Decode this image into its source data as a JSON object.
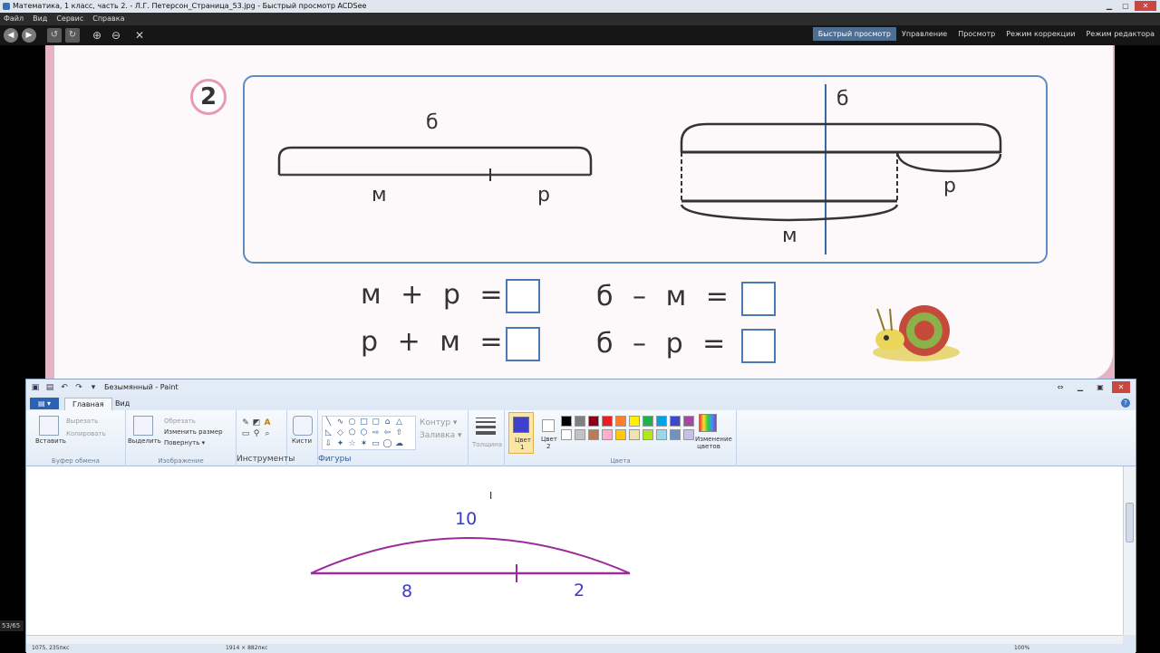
{
  "acdsee": {
    "title": "Математика, 1 класс, часть 2. - Л.Г. Петерсон_Страница_53.jpg - Быстрый просмотр ACDSee",
    "menu": [
      "Файл",
      "Вид",
      "Сервис",
      "Справка"
    ],
    "modes": [
      "Быстрый просмотр",
      "Управление",
      "Просмотр",
      "Режим коррекции",
      "Режим редактора"
    ],
    "active_mode": "Быстрый просмотр",
    "page_counter": "53/65"
  },
  "textbook": {
    "task_number": "2",
    "left_diagram": {
      "top": "б",
      "left_part": "м",
      "right_part": "р"
    },
    "right_diagram": {
      "top": "б",
      "right_part": "р",
      "bottom": "м"
    },
    "equations": [
      {
        "text": "м + р ="
      },
      {
        "text": "р + м ="
      },
      {
        "text": "б – м ="
      },
      {
        "text": "б – р ="
      }
    ]
  },
  "paint": {
    "title": "Безымянный - Paint",
    "file_tab": "▤ ▾",
    "tabs": [
      "Главная",
      "Вид"
    ],
    "active_tab": "Главная",
    "clipboard": {
      "paste": "Вставить",
      "cut": "Вырезать",
      "copy": "Копировать",
      "label": "Буфер обмена"
    },
    "image": {
      "select": "Выделить",
      "crop": "Обрезать",
      "resize": "Изменить размер",
      "rotate": "Повернуть ▾",
      "label": "Изображение"
    },
    "tools": {
      "label": "Инструменты"
    },
    "brushes": {
      "label": "Кисти"
    },
    "shapes": {
      "outline": "Контур ▾",
      "fill": "Заливка ▾",
      "label": "Фигуры"
    },
    "size": {
      "label": "Толщина"
    },
    "color1": {
      "label1": "Цвет",
      "label2": "1",
      "value": "#3f3fd0"
    },
    "color2": {
      "label1": "Цвет",
      "label2": "2",
      "value": "#ffffff"
    },
    "colors": {
      "label": "Цвета",
      "edit": "Изменение цветов"
    },
    "palette_row1": [
      "#000000",
      "#7f7f7f",
      "#880015",
      "#ed1c24",
      "#ff7f27",
      "#fff200",
      "#22b14c",
      "#00a2e8",
      "#3f48cc",
      "#a349a4"
    ],
    "palette_row2": [
      "#ffffff",
      "#c3c3c3",
      "#b97a57",
      "#ffaec9",
      "#ffc90e",
      "#efe4b0",
      "#b5e61d",
      "#99d9ea",
      "#7092be",
      "#c8bfe7"
    ],
    "drawing": {
      "total": "10",
      "left": "8",
      "right": "2",
      "stroke_color": "#9b2a9b",
      "text_color": "#3b3bc0"
    },
    "status": {
      "cursor_pos": "1075, 235пкс",
      "canvas_size": "1914 × 882пкс",
      "zoom": "100%"
    }
  }
}
